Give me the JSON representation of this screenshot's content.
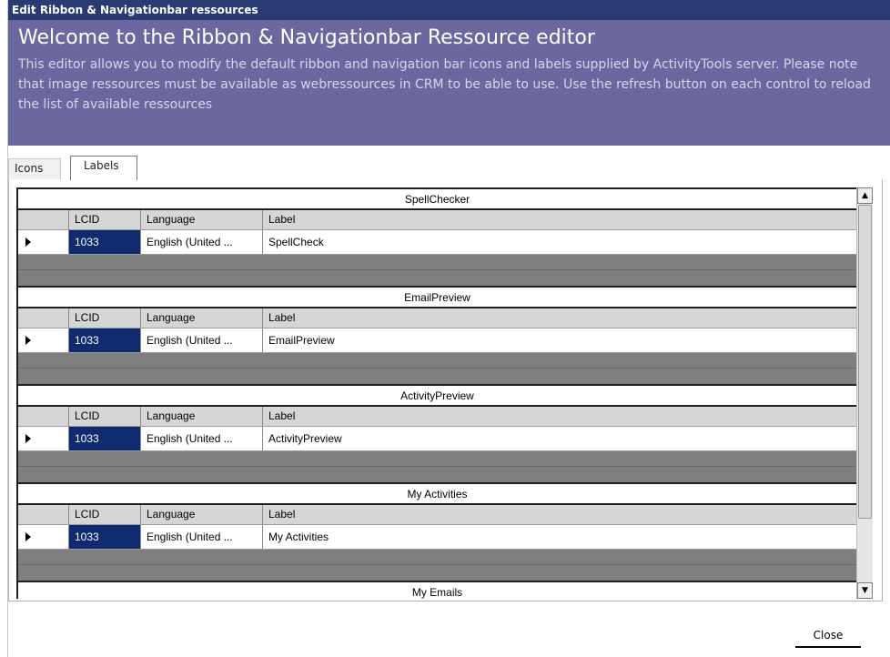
{
  "window": {
    "title": "Edit Ribbon & Navigationbar ressources"
  },
  "banner": {
    "heading": "Welcome to the Ribbon & Navigationbar Ressource editor",
    "description": "This editor allows you to modify the default ribbon and navigation bar icons and labels supplied by ActivityTools server. Please note that image ressources must be available as webressources in CRM to be able to use. Use the refresh button on each control to reload the list of available ressources"
  },
  "tabs": [
    {
      "label": "Icons",
      "active": false
    },
    {
      "label": "Labels",
      "active": true
    }
  ],
  "grid": {
    "columns": {
      "lcid": "LCID",
      "language": "Language",
      "label": "Label"
    },
    "groups": [
      {
        "name": "SpellChecker",
        "rows": [
          {
            "lcid": "1033",
            "language": "English (United ...",
            "label": "SpellCheck"
          }
        ]
      },
      {
        "name": "EmailPreview",
        "rows": [
          {
            "lcid": "1033",
            "language": "English (United ...",
            "label": "EmailPreview"
          }
        ]
      },
      {
        "name": "ActivityPreview",
        "rows": [
          {
            "lcid": "1033",
            "language": "English (United ...",
            "label": "ActivityPreview"
          }
        ]
      },
      {
        "name": "My Activities",
        "rows": [
          {
            "lcid": "1033",
            "language": "English (United ...",
            "label": "My Activities"
          }
        ]
      },
      {
        "name": "My Emails",
        "rows": []
      }
    ]
  },
  "scrollbar": {
    "up_icon": "triangle-up-icon",
    "down_icon": "triangle-down-icon"
  },
  "footer": {
    "close_label": "Close"
  },
  "colors": {
    "titlebar": "#2a3a72",
    "banner": "#6b689f",
    "selected_cell": "#0f2a6e",
    "grid_background": "#7f7f7f"
  }
}
